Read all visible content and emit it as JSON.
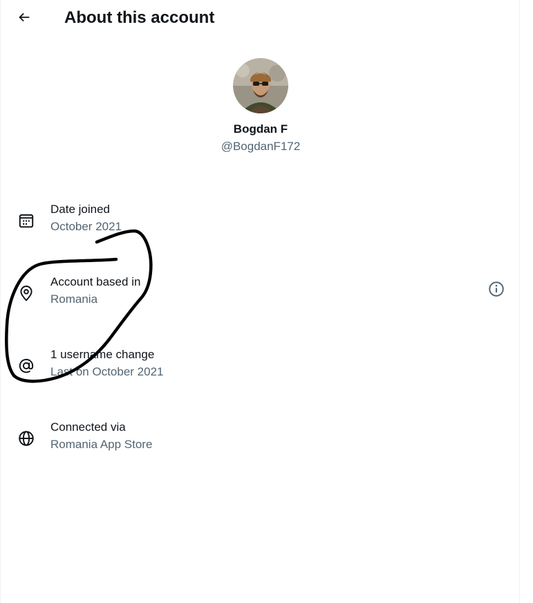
{
  "header": {
    "title": "About this account",
    "back_icon": "arrow-left-icon"
  },
  "profile": {
    "display_name": "Bogdan F",
    "handle": "@BogdanF172"
  },
  "rows": [
    {
      "icon": "calendar-icon",
      "title": "Date joined",
      "value": "October 2021"
    },
    {
      "icon": "location-pin-icon",
      "title": "Account based in",
      "value": "Romania",
      "action_icon": "info-icon"
    },
    {
      "icon": "at-sign-icon",
      "title": "1 username change",
      "value": "Last on October 2021"
    },
    {
      "icon": "globe-icon",
      "title": "Connected via",
      "value": "Romania App Store"
    }
  ],
  "colors": {
    "primary_text": "#0f1419",
    "secondary_text": "#536471",
    "annotation_ink": "#000000"
  }
}
